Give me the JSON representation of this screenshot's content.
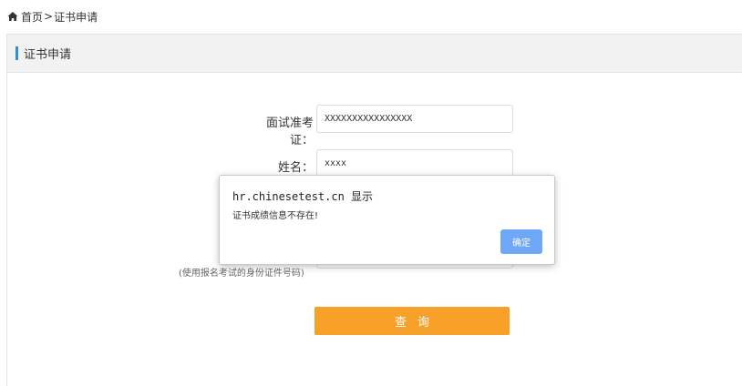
{
  "breadcrumb": {
    "home": "首页",
    "separator": ">",
    "current": "证书申请"
  },
  "panel": {
    "title": "证书申请",
    "accent_color": "#2f8fd8"
  },
  "form": {
    "exam_id_label": "面试准考证：",
    "exam_id_value": "XXXXXXXXXXXXXXXX",
    "name_label": "姓名：",
    "name_value": "xxxx",
    "id_hint": "(使用报名考试的身份证件号码)",
    "query_button": "查询",
    "query_button_color": "#f8a12a"
  },
  "dialog": {
    "title": "hr.chinesetest.cn 显示",
    "message": "证书成绩信息不存在!",
    "ok_button": "确定",
    "ok_button_color": "#6ea7f5"
  }
}
